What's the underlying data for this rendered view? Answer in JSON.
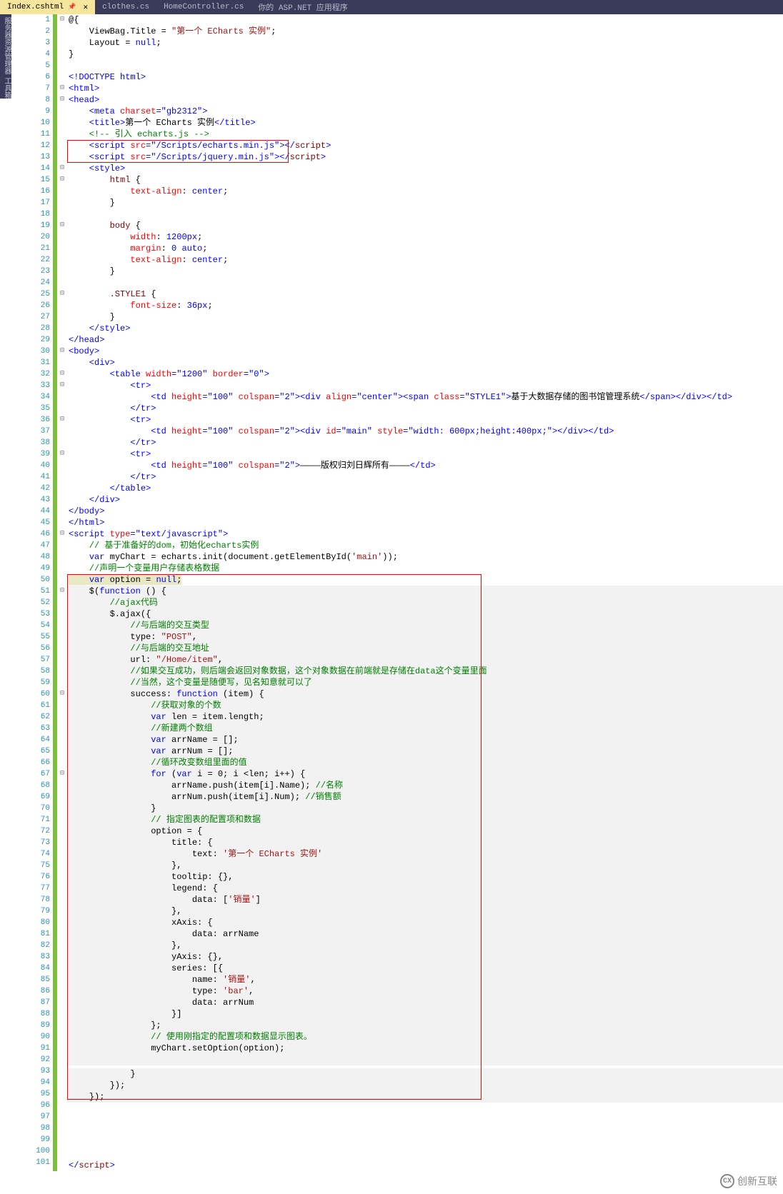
{
  "tabs": [
    {
      "label": "Index.cshtml",
      "active": true,
      "pinned": true,
      "closeable": true
    },
    {
      "label": "clothes.cs",
      "active": false
    },
    {
      "label": "HomeController.cs",
      "active": false
    },
    {
      "label": "你的 ASP.NET 应用程序",
      "active": false
    }
  ],
  "sidepanels": [
    "服务器资源管理器",
    "工具箱"
  ],
  "watermark": "创新互联",
  "code": {
    "l1": "@{",
    "l2_a": "    ViewBag.Title = ",
    "l2_b": "\"第一个 ECharts 实例\"",
    "l2_c": ";",
    "l3_a": "    Layout = ",
    "l3_b": "null",
    "l3_c": ";",
    "l4": "}",
    "l5": "",
    "l6": "<!DOCTYPE html>",
    "l7": "<html>",
    "l8": "<head>",
    "l9_a": "    <meta ",
    "l9_b": "charset",
    "l9_c": "=\"gb2312\"",
    "l9_d": ">",
    "l10_a": "    <title>",
    "l10_b": "第一个 ECharts 实例",
    "l10_c": "</title>",
    "l11": "    <!-- 引入 echarts.js -->",
    "l12_a": "    <script ",
    "l12_b": "src",
    "l12_c": "=\"/Scripts/echarts.min.js\"",
    "l12_d": "></",
    "l12_e": "script",
    "l12_f": ">",
    "l13_a": "    <script ",
    "l13_b": "src",
    "l13_c": "=\"/Scripts/jquery.min.js\"",
    "l13_d": "></",
    "l13_e": "script",
    "l13_f": ">",
    "l14": "    <style>",
    "l15_a": "        ",
    "l15_b": "html",
    "l15_c": " {",
    "l16_a": "            ",
    "l16_b": "text-align",
    "l16_c": ": ",
    "l16_d": "center",
    "l16_e": ";",
    "l17": "        }",
    "l18": "",
    "l19_a": "        ",
    "l19_b": "body",
    "l19_c": " {",
    "l20_a": "            ",
    "l20_b": "width",
    "l20_c": ": ",
    "l20_d": "1200px",
    "l20_e": ";",
    "l21_a": "            ",
    "l21_b": "margin",
    "l21_c": ": ",
    "l21_d": "0 auto",
    "l21_e": ";",
    "l22_a": "            ",
    "l22_b": "text-align",
    "l22_c": ": ",
    "l22_d": "center",
    "l22_e": ";",
    "l23": "        }",
    "l24": "",
    "l25_a": "        ",
    "l25_b": ".STYLE1",
    "l25_c": " {",
    "l26_a": "            ",
    "l26_b": "font-size",
    "l26_c": ": ",
    "l26_d": "36px",
    "l26_e": ";",
    "l27": "        }",
    "l28": "    </style>",
    "l29": "</head>",
    "l30": "<body>",
    "l31": "    <div>",
    "l32_a": "        <table ",
    "l32_b": "width",
    "l32_c": "=\"1200\" ",
    "l32_d": "border",
    "l32_e": "=\"0\"",
    "l32_f": ">",
    "l33": "            <tr>",
    "l34_a": "                <td ",
    "l34_b": "height",
    "l34_c": "=\"100\" ",
    "l34_d": "colspan",
    "l34_e": "=\"2\"",
    "l34_f": "><div ",
    "l34_g": "align",
    "l34_h": "=\"center\"",
    "l34_i": "><span ",
    "l34_j": "class",
    "l34_k": "=\"STYLE1\"",
    "l34_l": ">",
    "l34_m": "基于大数据存储的图书馆管理系统",
    "l34_n": "</span></div></td>",
    "l35": "            </tr>",
    "l36": "            <tr>",
    "l37_a": "                <td ",
    "l37_b": "height",
    "l37_c": "=\"100\" ",
    "l37_d": "colspan",
    "l37_e": "=\"2\"",
    "l37_f": "><div ",
    "l37_g": "id",
    "l37_h": "=\"main\" ",
    "l37_i": "style",
    "l37_j": "=\"width: 600px;height:400px;\"",
    "l37_k": "></div></td>",
    "l38": "            </tr>",
    "l39": "            <tr>",
    "l40_a": "                <td ",
    "l40_b": "height",
    "l40_c": "=\"100\" ",
    "l40_d": "colspan",
    "l40_e": "=\"2\"",
    "l40_f": ">",
    "l40_g": "————版权归刘日辉所有————",
    "l40_h": "</td>",
    "l41": "            </tr>",
    "l42": "        </table>",
    "l43": "    </div>",
    "l44": "</body>",
    "l45": "</html>",
    "l46_a": "<script ",
    "l46_b": "type",
    "l46_c": "=\"text/javascript\"",
    "l46_d": ">",
    "l47": "    // 基于准备好的dom，初始化echarts实例",
    "l48_a": "    ",
    "l48_b": "var",
    "l48_c": " myChart = echarts.init(document.getElementById(",
    "l48_d": "'main'",
    "l48_e": "));",
    "l49": "    //声明一个变量用户存储表格数据",
    "l50_a": "    ",
    "l50_b": "var",
    "l50_c": " option = ",
    "l50_d": "null",
    "l50_e": ";",
    "l51_a": "    $(",
    "l51_b": "function",
    "l51_c": " () {",
    "l52": "        //ajax代码",
    "l53": "        $.ajax({",
    "l54": "            //与后端的交互类型",
    "l55_a": "            type: ",
    "l55_b": "\"POST\"",
    "l55_c": ",",
    "l56": "            //与后端的交互地址",
    "l57_a": "            url: ",
    "l57_b": "\"/Home/item\"",
    "l57_c": ",",
    "l58": "            //如果交互成功，则后端会返回对象数据，这个对象数据在前端就是存储在data这个变量里面",
    "l59": "            //当然，这个变量是随便写，见名知意就可以了",
    "l60_a": "            success: ",
    "l60_b": "function",
    "l60_c": " (item) {",
    "l61": "                //获取对象的个数",
    "l62_a": "                ",
    "l62_b": "var",
    "l62_c": " len = item.length;",
    "l63": "                //新建两个数组",
    "l64_a": "                ",
    "l64_b": "var",
    "l64_c": " arrName = [];",
    "l65_a": "                ",
    "l65_b": "var",
    "l65_c": " arrNum = [];",
    "l66": "                //循环改变数组里面的值",
    "l67_a": "                ",
    "l67_b": "for",
    "l67_c": " (",
    "l67_d": "var",
    "l67_e": " i = 0; i <len; i++) {",
    "l68_a": "                    arrName.push(item[i].Name); ",
    "l68_b": "//名称",
    "l69_a": "                    arrNum.push(item[i].Num); ",
    "l69_b": "//销售额",
    "l70": "                }",
    "l71": "                // 指定图表的配置项和数据",
    "l72": "                option = {",
    "l73": "                    title: {",
    "l74_a": "                        text: ",
    "l74_b": "'第一个 ECharts 实例'",
    "l75": "                    },",
    "l76": "                    tooltip: {},",
    "l77": "                    legend: {",
    "l78_a": "                        data: [",
    "l78_b": "'销量'",
    "l78_c": "]",
    "l79": "                    },",
    "l80": "                    xAxis: {",
    "l81": "                        data: arrName",
    "l82": "                    },",
    "l83": "                    yAxis: {},",
    "l84": "                    series: [{",
    "l85_a": "                        name: ",
    "l85_b": "'销量'",
    "l85_c": ",",
    "l86_a": "                        type: ",
    "l86_b": "'bar'",
    "l86_c": ",",
    "l87": "                        data: arrNum",
    "l88": "                    }]",
    "l89": "                };",
    "l90": "                // 使用刚指定的配置项和数据显示图表。",
    "l91": "                myChart.setOption(option);",
    "l92": "",
    "l93": "            }",
    "l94": "        });",
    "l95": "    });",
    "l96": "",
    "l97": "",
    "l98": "",
    "l99": "",
    "l100": "",
    "l101_a": "</",
    "l101_b": "script",
    "l101_c": ">"
  }
}
